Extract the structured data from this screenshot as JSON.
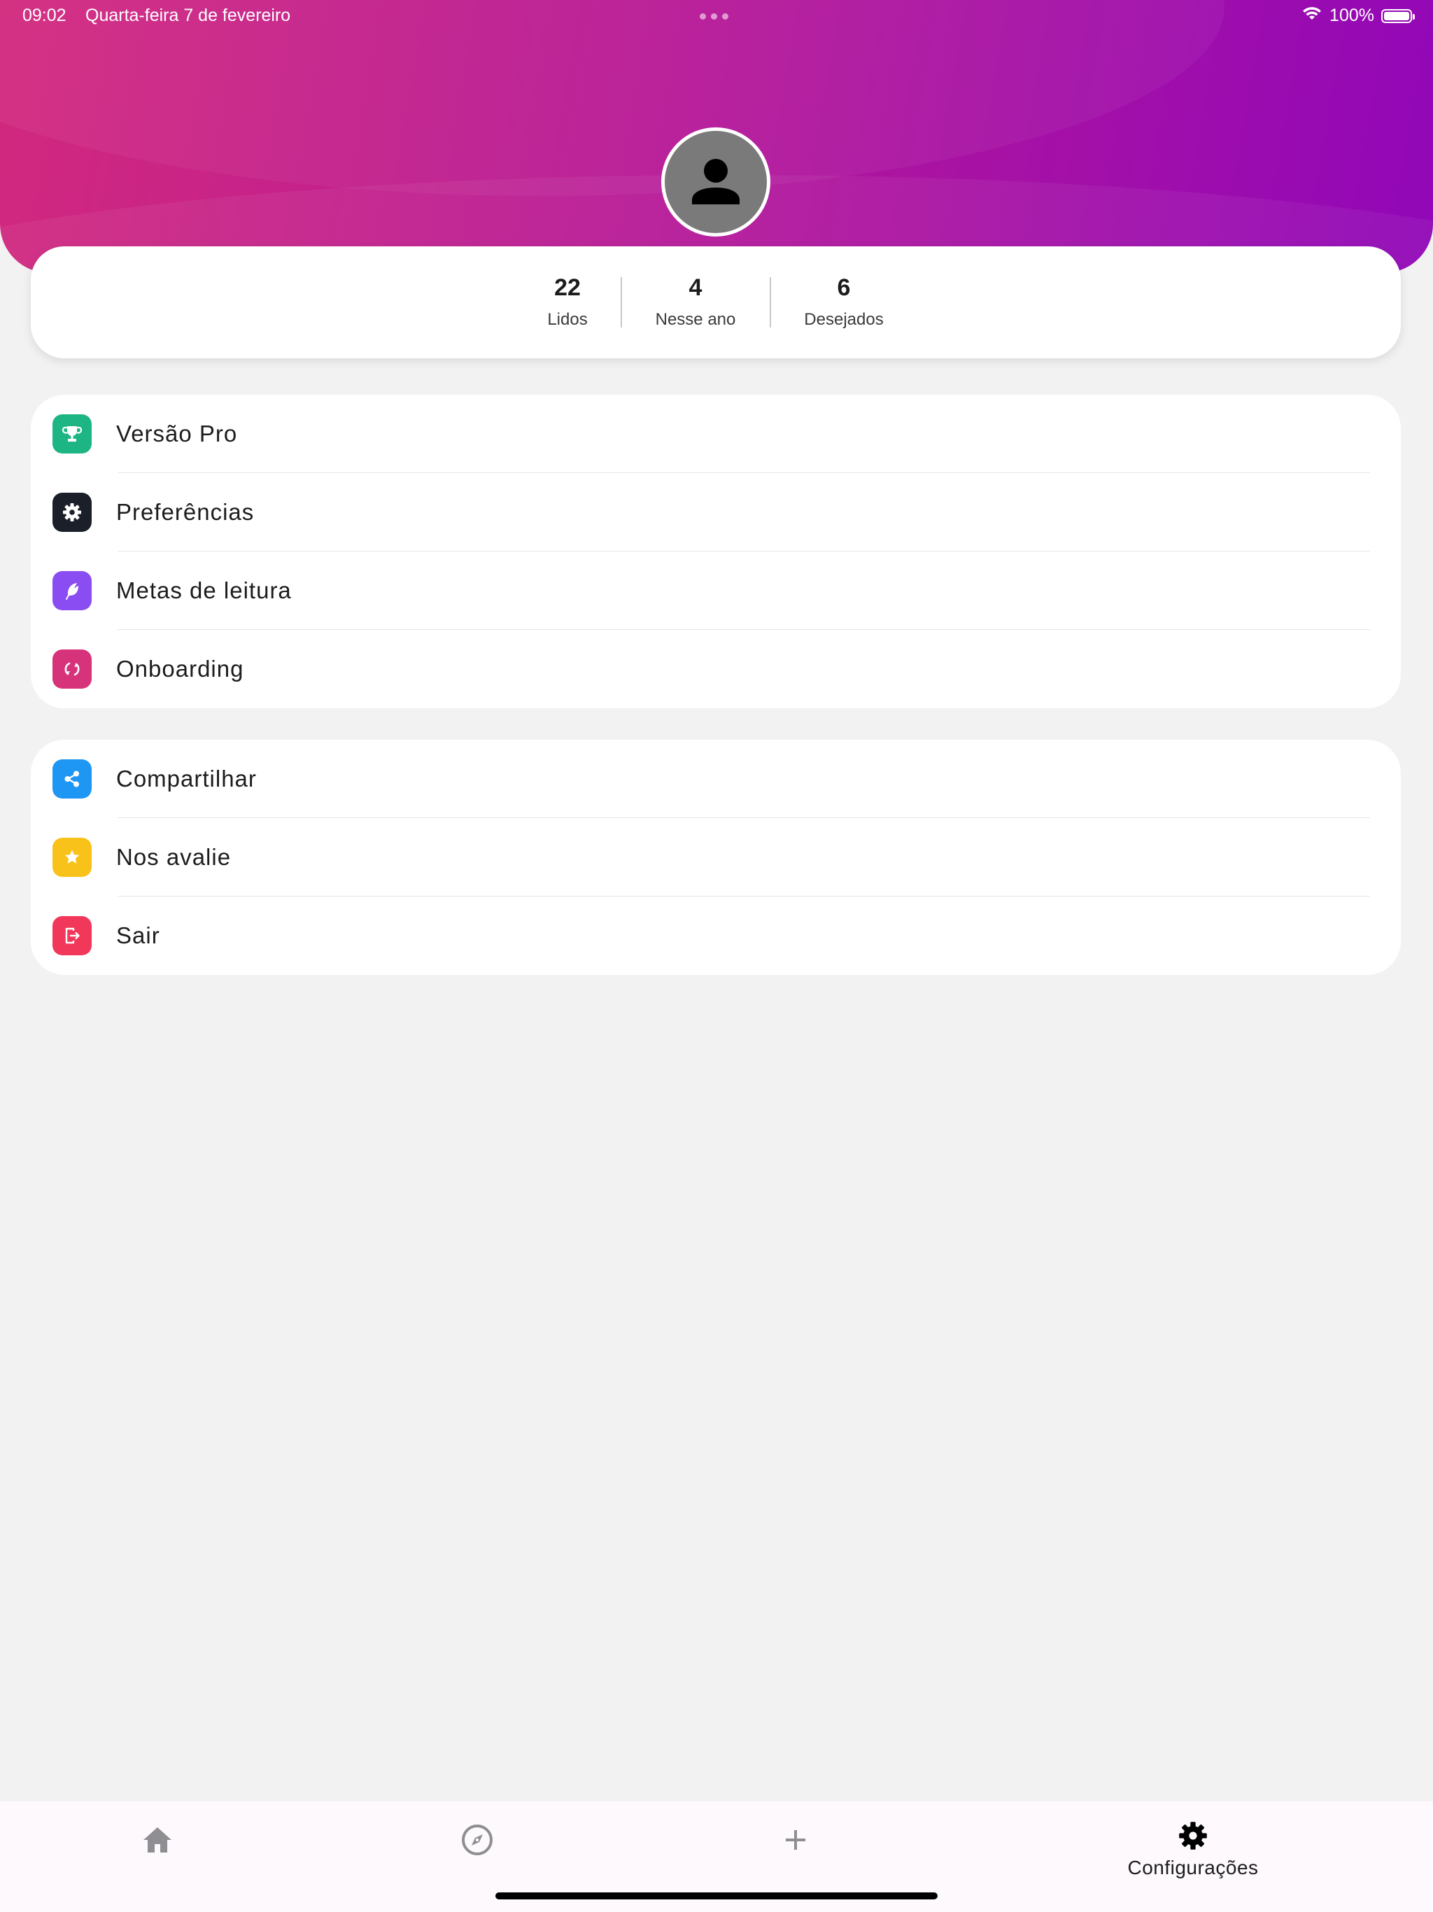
{
  "status_bar": {
    "time": "09:02",
    "date": "Quarta-feira 7 de fevereiro",
    "battery": "100%"
  },
  "profile": {
    "avatar_icon": "person-icon"
  },
  "stats": [
    {
      "value": "22",
      "label": "Lidos"
    },
    {
      "value": "4",
      "label": "Nesse ano"
    },
    {
      "value": "6",
      "label": "Desejados"
    }
  ],
  "menu_group_1": [
    {
      "label": "Versão Pro",
      "icon": "trophy-icon",
      "color": "#1db584"
    },
    {
      "label": "Preferências",
      "icon": "gear-icon",
      "color": "#1b1f2a"
    },
    {
      "label": "Metas de leitura",
      "icon": "feather-icon",
      "color": "#8a4df2"
    },
    {
      "label": "Onboarding",
      "icon": "refresh-icon",
      "color": "#d6337a"
    }
  ],
  "menu_group_2": [
    {
      "label": "Compartilhar",
      "icon": "share-icon",
      "color": "#1e96f3"
    },
    {
      "label": "Nos avalie",
      "icon": "star-icon",
      "color": "#f9c21a"
    },
    {
      "label": "Sair",
      "icon": "logout-icon",
      "color": "#f2385a"
    }
  ],
  "tab_bar": {
    "settings_label": "Configurações",
    "active_color": "#000000",
    "inactive_color": "#8e8e93"
  }
}
